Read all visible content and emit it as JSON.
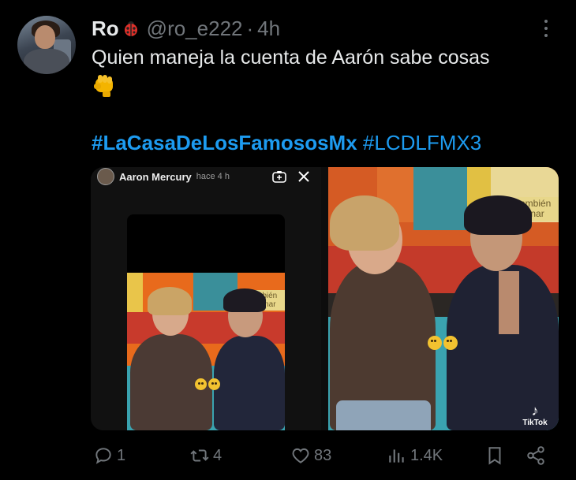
{
  "tweet": {
    "author_name": "Ro",
    "handle": "@ro_e222",
    "separator": "·",
    "time": "4h",
    "text": "Quien maneja la cuenta de Aarón sabe cosas",
    "hashtag_1": "#LaCasaDeLosFamososMx",
    "hashtag_2": "#LCDLFMX3"
  },
  "media": {
    "story_user": "Aaron Mercury",
    "story_time": "hace 4 h",
    "sign_left": "mbién ganar",
    "sign_right": "ambién ganar",
    "watermark": "TikTok"
  },
  "actions": {
    "replies": "1",
    "reposts": "4",
    "likes": "83",
    "views": "1.4K"
  },
  "colors": {
    "link": "#1d9bf0",
    "muted": "#71767b",
    "text": "#e7e9ea",
    "background": "#000000"
  }
}
